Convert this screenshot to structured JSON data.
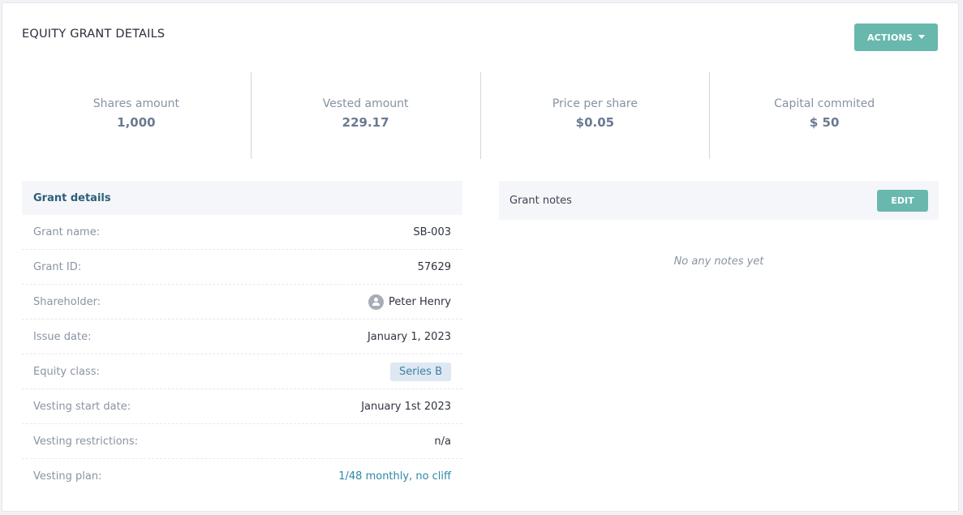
{
  "header": {
    "title": "EQUITY GRANT DETAILS",
    "actions_label": "ACTIONS"
  },
  "stats": [
    {
      "label": "Shares amount",
      "value": "1,000"
    },
    {
      "label": "Vested amount",
      "value": "229.17"
    },
    {
      "label": "Price per share",
      "value": "$0.05"
    },
    {
      "label": "Capital commited",
      "value": "$ 50"
    }
  ],
  "grant_details": {
    "title": "Grant details",
    "rows": [
      {
        "label": "Grant name:",
        "value": "SB-003"
      },
      {
        "label": "Grant ID:",
        "value": "57629"
      },
      {
        "label": "Shareholder:",
        "value": "Peter Henry"
      },
      {
        "label": "Issue date:",
        "value": "January 1, 2023"
      },
      {
        "label": "Equity class:",
        "value": "Series B"
      },
      {
        "label": "Vesting start date:",
        "value": "January 1st 2023"
      },
      {
        "label": "Vesting restrictions:",
        "value": "n/a"
      },
      {
        "label": "Vesting plan:",
        "value": "1/48 monthly, no cliff"
      }
    ]
  },
  "grant_notes": {
    "title": "Grant notes",
    "edit_label": "EDIT",
    "empty_text": "No any notes yet"
  },
  "icons": {
    "actions_caret": "caret-down-icon",
    "shareholder_avatar": "user-avatar-icon"
  },
  "colors": {
    "accent": "#69b8ad",
    "heading": "#2d5f76",
    "link": "#2d86a8",
    "badge_bg": "#dde8f3"
  }
}
